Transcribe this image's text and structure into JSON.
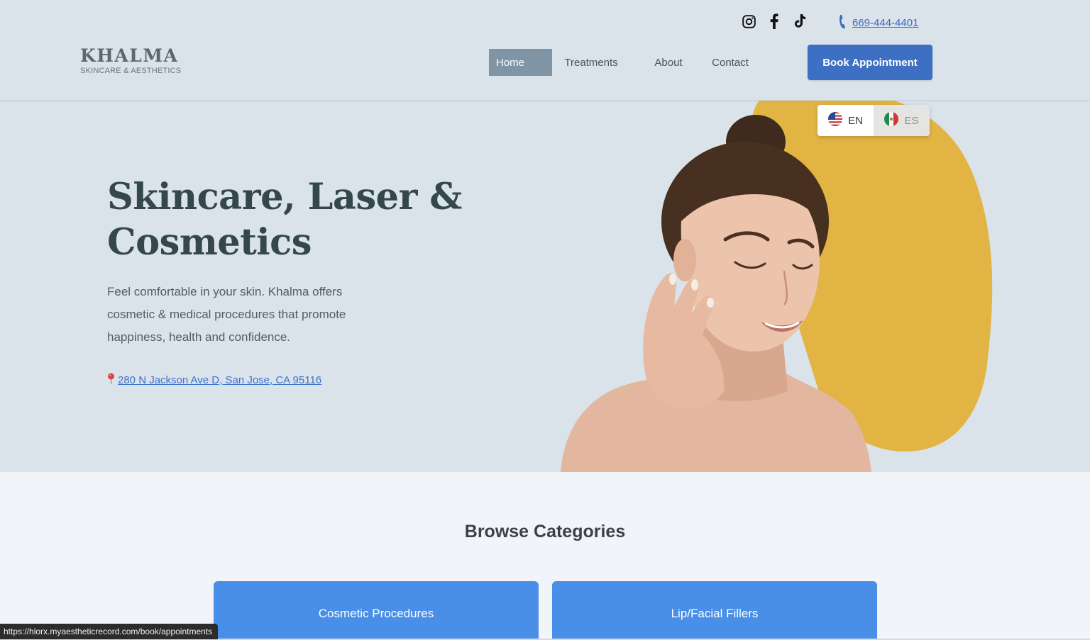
{
  "header": {
    "logo_title": "KHALMA",
    "logo_subtitle": "SKINCARE & AESTHETICS",
    "social_icons": [
      "instagram-icon",
      "facebook-icon",
      "tiktok-icon"
    ],
    "phone": "669-444-4401",
    "nav": [
      "Home",
      "Treatments",
      "About",
      "Contact"
    ],
    "active_nav": "Home",
    "book_button": "Book Appointment"
  },
  "language": {
    "options": [
      {
        "code": "EN",
        "flag": "us-flag-icon",
        "selected": true
      },
      {
        "code": "ES",
        "flag": "mx-flag-icon",
        "selected": false
      }
    ]
  },
  "hero": {
    "title_line1": "Skincare, Laser &",
    "title_line2": "Cosmetics",
    "description": "Feel comfortable in your skin. Khalma offers cosmetic & medical procedures that promote happiness, health and confidence.",
    "address": "280 N Jackson Ave D, San Jose, CA 95116"
  },
  "categories": {
    "title": "Browse Categories",
    "items": [
      "Cosmetic Procedures",
      "Lip/Facial Fillers"
    ]
  },
  "status_url": "https://hlorx.myaestheticrecord.com/book/appointments",
  "colors": {
    "header_bg": "#dae2ea",
    "accent_blue": "#3d6fc2",
    "card_blue": "#4a8fe7",
    "blob_yellow": "#e2b443",
    "nav_active": "#7f95a6"
  }
}
